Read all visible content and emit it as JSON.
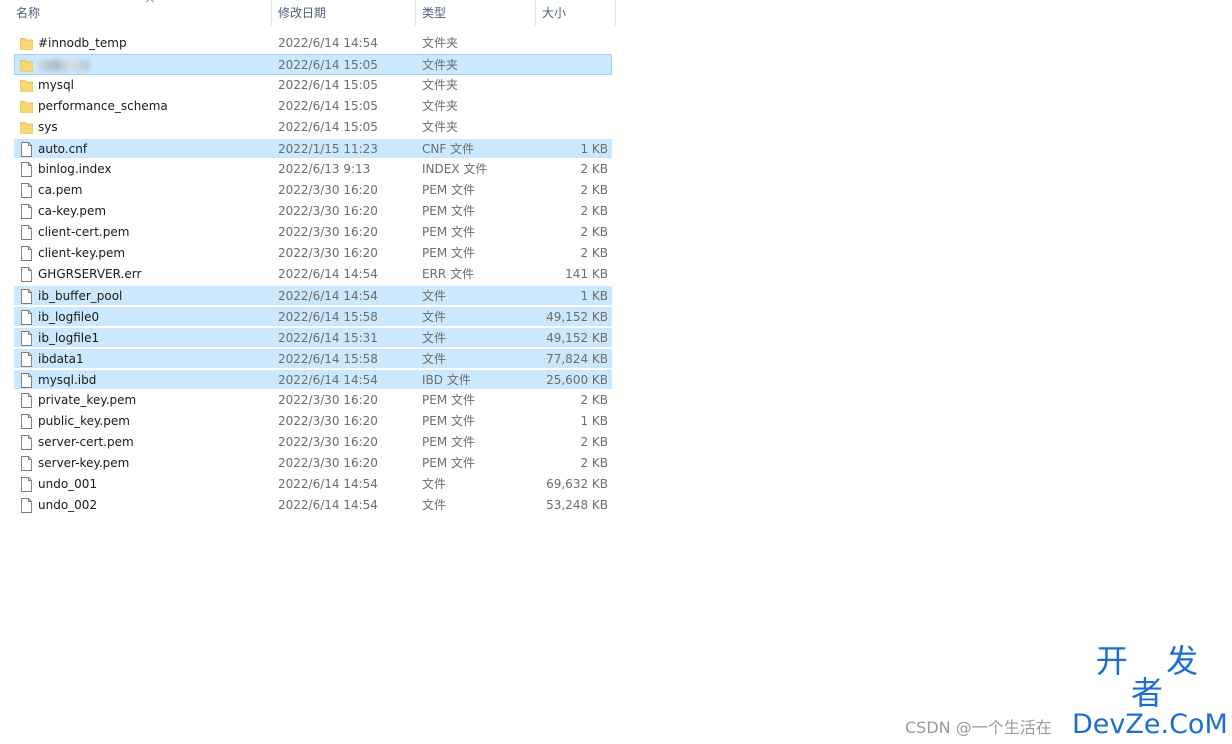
{
  "columns": {
    "name": "名称",
    "date": "修改日期",
    "type": "类型",
    "size": "大小"
  },
  "sort_icon": "sort-up-chevron-icon",
  "files": [
    {
      "name": "#innodb_temp",
      "date": "2022/6/14 14:54",
      "type": "文件夹",
      "size": "",
      "icon": "folder-icon",
      "selected": false
    },
    {
      "name": "",
      "date": "2022/6/14 15:05",
      "type": "文件夹",
      "size": "",
      "icon": "folder-icon",
      "selected": true,
      "focused": true,
      "name_blurred": true
    },
    {
      "name": "mysql",
      "date": "2022/6/14 15:05",
      "type": "文件夹",
      "size": "",
      "icon": "folder-icon",
      "selected": false
    },
    {
      "name": "performance_schema",
      "date": "2022/6/14 15:05",
      "type": "文件夹",
      "size": "",
      "icon": "folder-icon",
      "selected": false
    },
    {
      "name": "sys",
      "date": "2022/6/14 15:05",
      "type": "文件夹",
      "size": "",
      "icon": "folder-icon",
      "selected": false
    },
    {
      "name": "auto.cnf",
      "date": "2022/1/15 11:23",
      "type": "CNF 文件",
      "size": "1 KB",
      "icon": "file-icon",
      "selected": true
    },
    {
      "name": "binlog.index",
      "date": "2022/6/13 9:13",
      "type": "INDEX 文件",
      "size": "2 KB",
      "icon": "file-icon",
      "selected": false
    },
    {
      "name": "ca.pem",
      "date": "2022/3/30 16:20",
      "type": "PEM 文件",
      "size": "2 KB",
      "icon": "file-icon",
      "selected": false
    },
    {
      "name": "ca-key.pem",
      "date": "2022/3/30 16:20",
      "type": "PEM 文件",
      "size": "2 KB",
      "icon": "file-icon",
      "selected": false
    },
    {
      "name": "client-cert.pem",
      "date": "2022/3/30 16:20",
      "type": "PEM 文件",
      "size": "2 KB",
      "icon": "file-icon",
      "selected": false
    },
    {
      "name": "client-key.pem",
      "date": "2022/3/30 16:20",
      "type": "PEM 文件",
      "size": "2 KB",
      "icon": "file-icon",
      "selected": false
    },
    {
      "name": "GHGRSERVER.err",
      "date": "2022/6/14 14:54",
      "type": "ERR 文件",
      "size": "141 KB",
      "icon": "file-icon",
      "selected": false
    },
    {
      "name": "ib_buffer_pool",
      "date": "2022/6/14 14:54",
      "type": "文件",
      "size": "1 KB",
      "icon": "file-icon",
      "selected": true
    },
    {
      "name": "ib_logfile0",
      "date": "2022/6/14 15:58",
      "type": "文件",
      "size": "49,152 KB",
      "icon": "file-icon",
      "selected": true
    },
    {
      "name": "ib_logfile1",
      "date": "2022/6/14 15:31",
      "type": "文件",
      "size": "49,152 KB",
      "icon": "file-icon",
      "selected": true
    },
    {
      "name": "ibdata1",
      "date": "2022/6/14 15:58",
      "type": "文件",
      "size": "77,824 KB",
      "icon": "file-icon",
      "selected": true
    },
    {
      "name": "mysql.ibd",
      "date": "2022/6/14 14:54",
      "type": "IBD 文件",
      "size": "25,600 KB",
      "icon": "file-icon",
      "selected": true
    },
    {
      "name": "private_key.pem",
      "date": "2022/3/30 16:20",
      "type": "PEM 文件",
      "size": "2 KB",
      "icon": "file-icon",
      "selected": false
    },
    {
      "name": "public_key.pem",
      "date": "2022/3/30 16:20",
      "type": "PEM 文件",
      "size": "1 KB",
      "icon": "file-icon",
      "selected": false
    },
    {
      "name": "server-cert.pem",
      "date": "2022/3/30 16:20",
      "type": "PEM 文件",
      "size": "2 KB",
      "icon": "file-icon",
      "selected": false
    },
    {
      "name": "server-key.pem",
      "date": "2022/3/30 16:20",
      "type": "PEM 文件",
      "size": "2 KB",
      "icon": "file-icon",
      "selected": false
    },
    {
      "name": "undo_001",
      "date": "2022/6/14 14:54",
      "type": "文件",
      "size": "69,632 KB",
      "icon": "file-icon",
      "selected": false
    },
    {
      "name": "undo_002",
      "date": "2022/6/14 14:54",
      "type": "文件",
      "size": "53,248 KB",
      "icon": "file-icon",
      "selected": false
    }
  ],
  "colors": {
    "selection": "#cce8ff",
    "selection_border": "#99d1ff",
    "folder": "#f8d775",
    "folder_dark": "#e0b640",
    "logo": "#1a6fd0"
  },
  "watermark": {
    "text": "CSDN @一个生活在",
    "logo_cn": "开 发 者",
    "logo_en": "DevZe.CoM"
  }
}
